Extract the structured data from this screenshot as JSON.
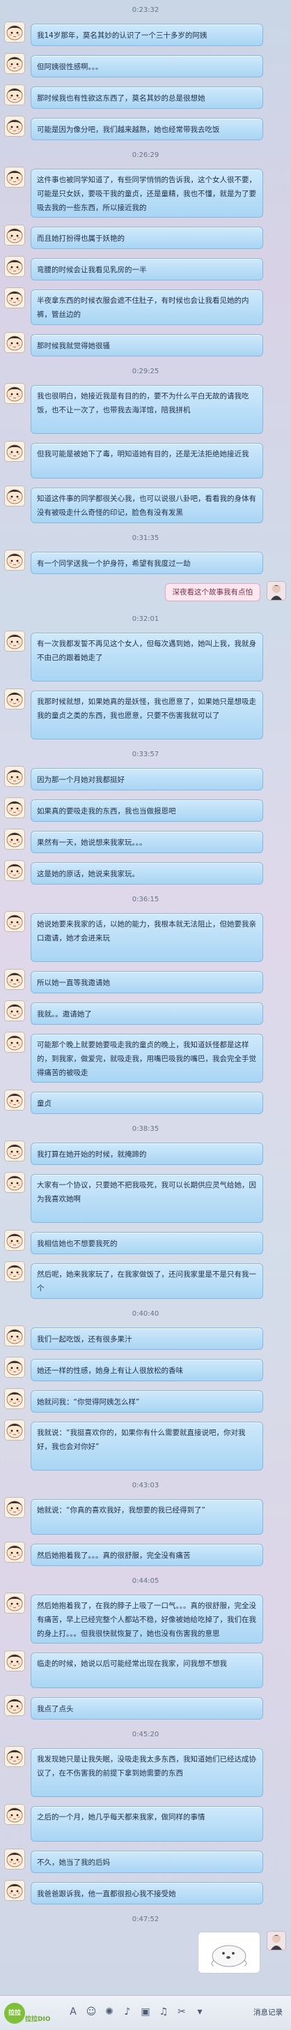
{
  "chat": {
    "items": [
      {
        "kind": "ts",
        "text": "0:23:32"
      },
      {
        "kind": "msg",
        "lines": 1,
        "text": "我14岁那年，莫名其妙的认识了一个三十多岁的阿姨"
      },
      {
        "kind": "msg",
        "lines": 1,
        "text": "但阿姨很性感啊。。。"
      },
      {
        "kind": "msg",
        "lines": 1,
        "text": "那时候我也有性欲这东西了，莫名其妙的总是很想她"
      },
      {
        "kind": "msg",
        "lines": 1,
        "text": "可能是因为像分吧，我们越来越熟，她也经常带我去吃饭"
      },
      {
        "kind": "ts",
        "text": "0:26:29"
      },
      {
        "kind": "msg",
        "lines": 3,
        "text": "这件事也被同学知道了，有些同学悄悄的告诉我，这个女人很不要，可能是只女妖，要吸干我的童贞，还是童精，我也不懂，就是为了要吸去我的一些东西，所以接近我的"
      },
      {
        "kind": "msg",
        "lines": 1,
        "text": "而且她打扮得也属于妖艳的"
      },
      {
        "kind": "msg",
        "lines": 1,
        "text": "弯腰的时候会让我看见乳房的一半"
      },
      {
        "kind": "msg",
        "lines": 2,
        "text": "半夜拿东西的时候衣服会遮不住肚子，有时候也会让我看见她的内裤，管丝边的"
      },
      {
        "kind": "msg",
        "lines": 1,
        "text": "那时候我就觉得她很骚"
      },
      {
        "kind": "ts",
        "text": "0:29:25"
      },
      {
        "kind": "msg",
        "lines": 3,
        "text": "我也很明白，她接近我是有目的的，要不为什么平白无故的请我吃饭，也不让一次了，也带我去海洋馆，陪我拼机"
      },
      {
        "kind": "msg",
        "lines": 2,
        "text": "但我可能是被她下了毒，明知道她有目的，还是无法拒绝她接近我"
      },
      {
        "kind": "msg",
        "lines": 2,
        "text": "知道这件事的同学都很关心我，也可以说很八卦吧，看看我的身体有没有被吸走什么奇怪的印记，脸色有没有发黑"
      },
      {
        "kind": "ts",
        "text": "0:31:35"
      },
      {
        "kind": "msg",
        "lines": 1,
        "text": "有一个同学送我一个护身符，希望有我度过一劫"
      },
      {
        "kind": "right",
        "text": "深夜看这个故事我有点怕"
      },
      {
        "kind": "ts",
        "text": "0:32:01"
      },
      {
        "kind": "msg",
        "lines": 3,
        "text": "有一次我都发誓不再见这个女人，但每次遇到她，她叫上我，我就身不由己的跟着她走了"
      },
      {
        "kind": "msg",
        "lines": 3,
        "text": "我那时候就想，如果她真的是妖怪，我也愿意了，如果她只是想吸走我的童贞之类的东西，我也愿意，只要不伤害我就可以了"
      },
      {
        "kind": "ts",
        "text": "0:33:57"
      },
      {
        "kind": "msg",
        "lines": 1,
        "text": "因为那一个月她对我都挺好"
      },
      {
        "kind": "msg",
        "lines": 1,
        "text": "如果真的要吸走我的东西，我也当做报恩吧"
      },
      {
        "kind": "msg",
        "lines": 1,
        "text": "果然有一天，她说想来我家玩。。。"
      },
      {
        "kind": "msg",
        "lines": 1,
        "text": "这是她的原话，她说来我家玩。"
      },
      {
        "kind": "ts",
        "text": "0:36:15"
      },
      {
        "kind": "msg",
        "lines": 3,
        "text": "她说她要来我家的话，以她的能力，我根本就无法阻止，但她要我亲口邀请，她才会进来玩"
      },
      {
        "kind": "msg",
        "lines": 1,
        "text": "所以她一直等我邀请她"
      },
      {
        "kind": "msg",
        "lines": 1,
        "text": "我就。。邀请她了"
      },
      {
        "kind": "msg",
        "lines": 3,
        "text": "可能那个晚上就要她要吸走我的童贞的晚上，我知道妖怪都是这样的，到我家，做爱完，就吸走我，用嘴巴吸我的嘴巴，我会完全手觉得痛苦的被吸走"
      },
      {
        "kind": "msg",
        "lines": 1,
        "text": "童贞"
      },
      {
        "kind": "ts",
        "text": "0:38:35"
      },
      {
        "kind": "msg",
        "lines": 1,
        "text": "我打算在她开始的时候，就掩蹄的"
      },
      {
        "kind": "msg",
        "lines": 3,
        "text": "大家有一个协议，只要她不把我吸死，我可以长期供应灵气给她，因为我喜欢她啊"
      },
      {
        "kind": "msg",
        "lines": 1,
        "text": "我相信她也不想要我死的"
      },
      {
        "kind": "msg",
        "lines": 2,
        "text": "然后呢，她来我家玩了，在我家做饭了，还问我家里是不是只有我一个"
      },
      {
        "kind": "ts",
        "text": "0:40:40"
      },
      {
        "kind": "msg",
        "lines": 1,
        "text": "我们一起吃饭，还有很多果汁"
      },
      {
        "kind": "msg",
        "lines": 1,
        "text": "她还一样的性感，她身上有让人很放松的香味"
      },
      {
        "kind": "msg",
        "lines": 1,
        "text": "她就问我：“你觉得阿姨怎么样”"
      },
      {
        "kind": "msg",
        "lines": 3,
        "text": "我就说：“我挺喜欢你的，如果你有什么需要就直接说吧，你对我好，我也会对你好”"
      },
      {
        "kind": "ts",
        "text": "0:43:03"
      },
      {
        "kind": "msg",
        "lines": 2,
        "text": "她就说：“你真的喜欢我好，我想要的我已经得到了”"
      },
      {
        "kind": "msg",
        "lines": 1,
        "text": "然后她抱着我了。。。真的很舒服，完全没有痛苦"
      },
      {
        "kind": "ts",
        "text": "0:44:05"
      },
      {
        "kind": "msg",
        "lines": 3,
        "text": "然后她抱着我了，在我的脖子上吸了一口气。。。真的很舒服，完全没有痛苦，早上已经完整个人都站不稳，好像被她给吃掉了，我们在我的身上打。。。但我很快就恢复了，她也没有伤害我的意思"
      },
      {
        "kind": "msg",
        "lines": 2,
        "text": "临走的时候，她说以后可能经常出现在我家，问我想不想我"
      },
      {
        "kind": "msg",
        "lines": 1,
        "text": "我点了点头"
      },
      {
        "kind": "ts",
        "text": "0:45:20"
      },
      {
        "kind": "msg",
        "lines": 3,
        "text": "我发现她只是让我失眠，没吸走我太多东西，我知道她们已经达成协议了，在不伤害我的前提下拿到她需要的东西"
      },
      {
        "kind": "msg",
        "lines": 2,
        "text": "之后的一个月，她几乎每天都来我家，做同样的事情"
      },
      {
        "kind": "msg",
        "lines": 1,
        "text": "不久，她当了我的后妈"
      },
      {
        "kind": "msg",
        "lines": 1,
        "text": "我爸爸跟诉我，他一直都很担心我不接受她"
      },
      {
        "kind": "ts",
        "text": "0:47:52"
      },
      {
        "kind": "sticker",
        "text": ""
      }
    ]
  },
  "toolbar": {
    "history_label": "消息记录",
    "brand_badge": "拉拉",
    "brand_name": "拉拉DIO",
    "tools": [
      {
        "icon": "font-icon",
        "glyph": "A"
      },
      {
        "icon": "emoji-icon",
        "glyph": "☺"
      },
      {
        "icon": "shake-icon",
        "glyph": "✺"
      },
      {
        "icon": "voice-icon",
        "glyph": "♪"
      },
      {
        "icon": "image-icon",
        "glyph": "▣"
      },
      {
        "icon": "music-icon",
        "glyph": "♫"
      },
      {
        "icon": "scissors-icon",
        "glyph": "✂"
      },
      {
        "icon": "dropdown-icon",
        "glyph": "▾"
      }
    ]
  },
  "colors": {
    "bubble": "#a9d5f4",
    "bubble_border": "#86b8de",
    "right_bubble": "#fbe7ef"
  }
}
